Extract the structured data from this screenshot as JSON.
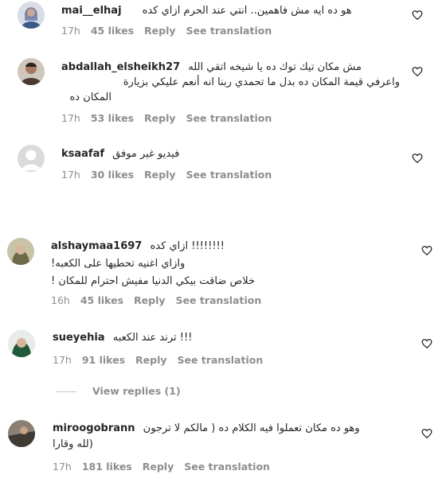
{
  "comments": [
    {
      "username": "mai__elhaj",
      "text_lines": [
        "هو ده ايه مش فاهمين.. انتي عند الحرم ازاي كده"
      ],
      "time": "17h",
      "likes": "45 likes",
      "reply": "Reply",
      "translate": "See translation"
    },
    {
      "username": "abdallah_elsheikh27",
      "text_lines": [
        "مش مكان تيك توك ده يا شيخه اتقي الله",
        "واعرفي قيمة المكان ده بدل ما تحمدي ربنا انه أنعم عليكي بزيارة",
        "المكان ده"
      ],
      "time": "17h",
      "likes": "53 likes",
      "reply": "Reply",
      "translate": "See translation"
    },
    {
      "username": "ksaafaf",
      "text_lines": [
        "فيديو غير موفق"
      ],
      "time": "17h",
      "likes": "30 likes",
      "reply": "Reply",
      "translate": "See translation"
    },
    {
      "username": "alshaymaa1697",
      "text_lines": [
        "ازاي كده !!!!!!!!",
        "!وازاي اغنيه تحطيها على الكعبه",
        "! خلاص ضاقت بيكي الدنيا مفيش احترام للمكان"
      ],
      "time": "16h",
      "likes": "45 likes",
      "reply": "Reply",
      "translate": "See translation"
    },
    {
      "username": "sueyehia",
      "text_lines": [
        "ترند عند الكعبه !!!"
      ],
      "time": "17h",
      "likes": "91 likes",
      "reply": "Reply",
      "translate": "See translation",
      "view_replies": "View replies (1)"
    },
    {
      "username": "miroogobrann",
      "text_lines": [
        "وهو ده مكان تعملوا فيه الكلام ده ( مالكم لا ترجون",
        "لله وقارا)"
      ],
      "time": "17h",
      "likes": "181 likes",
      "reply": "Reply",
      "translate": "See translation"
    }
  ],
  "colors": {
    "text": "#262626",
    "meta": "#8e8e8e",
    "background": "#ffffff"
  },
  "icons": {
    "like": "heart-outline-icon"
  }
}
